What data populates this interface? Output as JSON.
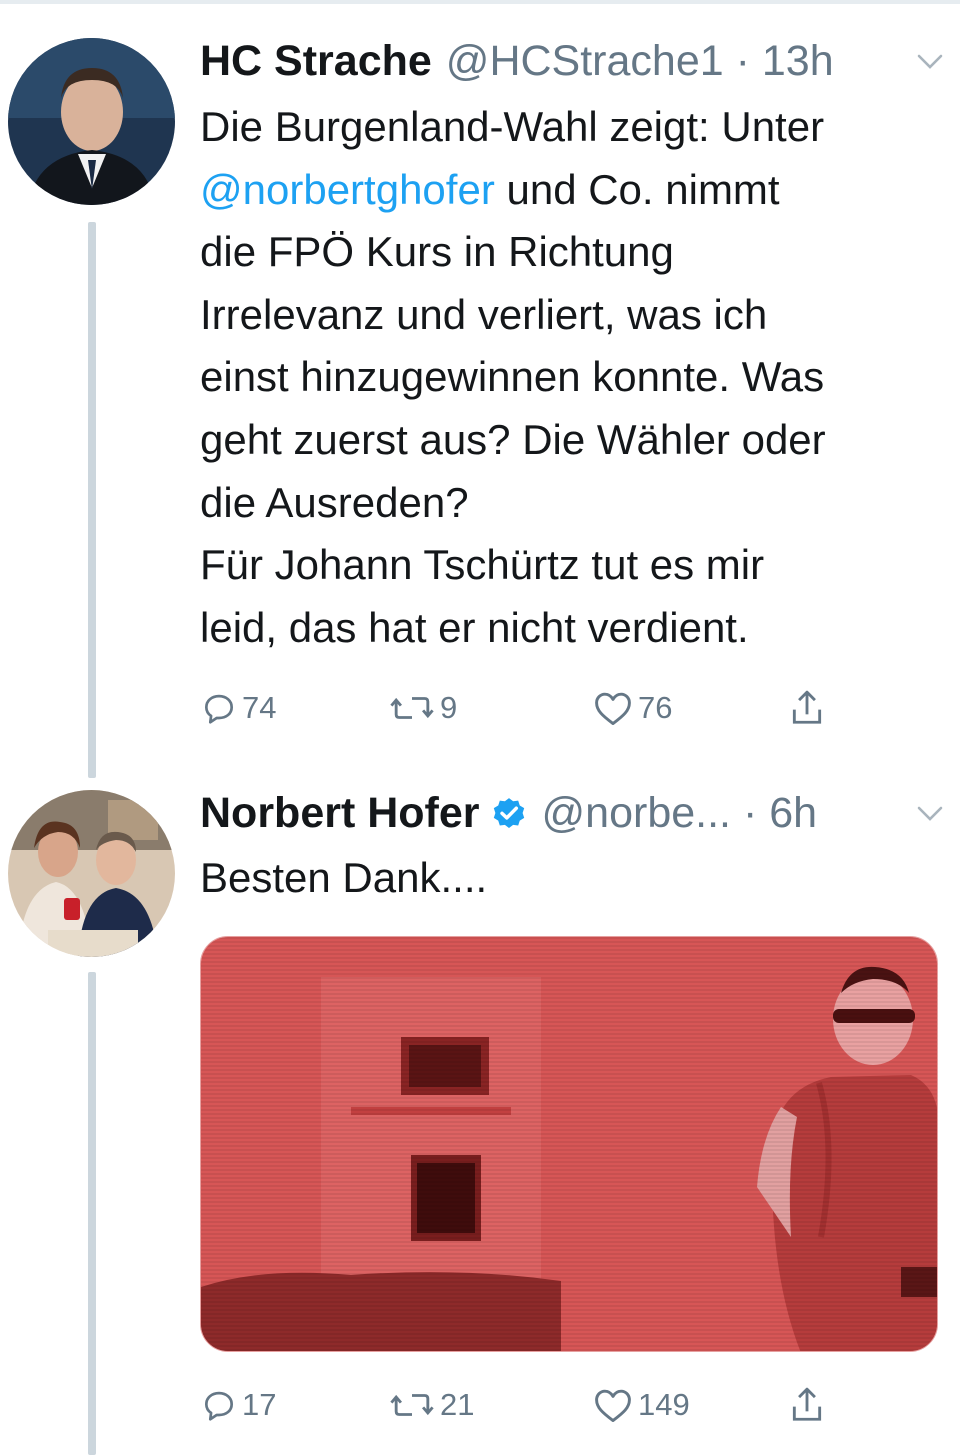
{
  "colors": {
    "link": "#1da1f2",
    "secondary_text": "#657786",
    "thread_line": "#ccd6dd",
    "verified": "#1da1f2",
    "media_tint": "#d85555"
  },
  "tweets": [
    {
      "display_name": "HC Strache",
      "handle": "@HCStrache1",
      "time": "13h",
      "meta": "@HCStrache1 · 13h",
      "verified": false,
      "menu_icon": "chevron-down-icon",
      "text_lines": [
        {
          "mention": "",
          "text": "Die Burgenland-Wahl zeigt: Unter"
        },
        {
          "mention": "@norbertghofer",
          "text": " und Co. nimmt"
        },
        {
          "mention": "",
          "text": "die FPÖ Kurs in Richtung"
        },
        {
          "mention": "",
          "text": "Irrelevanz und verliert, was ich"
        },
        {
          "mention": "",
          "text": "einst hinzugewinnen konnte. Was"
        },
        {
          "mention": "",
          "text": "geht zuerst aus? Die Wähler oder"
        },
        {
          "mention": "",
          "text": "die Ausreden?"
        },
        {
          "mention": "",
          "text": "Für Johann Tschürtz tut es mir"
        },
        {
          "mention": "",
          "text": "leid, das hat er nicht verdient."
        }
      ],
      "actions": {
        "reply": {
          "icon": "reply-icon",
          "count": "74"
        },
        "retweet": {
          "icon": "retweet-icon",
          "count": "9"
        },
        "like": {
          "icon": "heart-icon",
          "count": "76"
        },
        "share": {
          "icon": "share-icon",
          "count": ""
        }
      }
    },
    {
      "display_name": "Norbert Hofer",
      "handle": "@norbe...",
      "time": "6h",
      "meta": "@norbe... · 6h",
      "verified": true,
      "menu_icon": "chevron-down-icon",
      "text_lines": [
        {
          "mention": "",
          "text": "Besten Dank...."
        }
      ],
      "media": {
        "kind": "photo",
        "tint": "red"
      },
      "actions": {
        "reply": {
          "icon": "reply-icon",
          "count": "17"
        },
        "retweet": {
          "icon": "retweet-icon",
          "count": "21"
        },
        "like": {
          "icon": "heart-icon",
          "count": "149"
        },
        "share": {
          "icon": "share-icon",
          "count": ""
        }
      }
    }
  ]
}
